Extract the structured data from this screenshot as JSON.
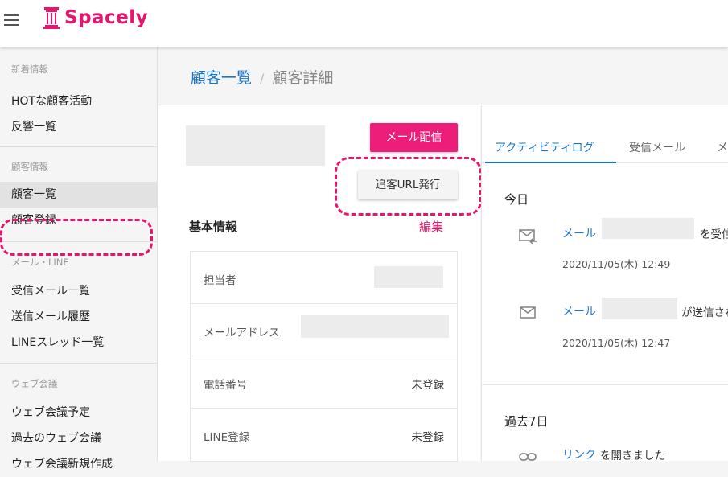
{
  "app": {
    "logo_text": "Spacely",
    "brand_color": "#e8156e"
  },
  "sidebar": {
    "sections": [
      {
        "title": "新着情報",
        "items": [
          {
            "label": "HOTな顧客活動"
          },
          {
            "label": "反響一覧"
          }
        ]
      },
      {
        "title": "顧客情報",
        "items": [
          {
            "label": "顧客一覧",
            "active": true
          },
          {
            "label": "顧客登録"
          }
        ]
      },
      {
        "title": "メール・LINE",
        "items": [
          {
            "label": "受信メール一覧"
          },
          {
            "label": "送信メール履歴"
          },
          {
            "label": "LINEスレッド一覧"
          }
        ]
      },
      {
        "title": "ウェブ会議",
        "items": [
          {
            "label": "ウェブ会議予定"
          },
          {
            "label": "過去のウェブ会議"
          },
          {
            "label": "ウェブ会議新規作成"
          }
        ]
      }
    ]
  },
  "breadcrumb": {
    "parent": "顧客一覧",
    "separator": "/",
    "current": "顧客詳細"
  },
  "customer": {
    "mail_button": "メール配信",
    "url_button": "追客URL発行",
    "basic_info_title": "基本情報",
    "edit_label": "編集",
    "fields": [
      {
        "label": "担当者",
        "value": ""
      },
      {
        "label": "メールアドレス",
        "value": ""
      },
      {
        "label": "電話番号",
        "value": "未登録"
      },
      {
        "label": "LINE登録",
        "value": "未登録"
      }
    ]
  },
  "activity": {
    "tabs": [
      {
        "label": "アクティビティログ",
        "active": true
      },
      {
        "label": "受信メール"
      },
      {
        "label": "メ"
      }
    ],
    "today_title": "今日",
    "past_title": "過去7日",
    "items": [
      {
        "icon": "mail-receive-icon",
        "link": "メール",
        "text": "を受信",
        "time": "2020/11/05(木) 12:49"
      },
      {
        "icon": "mail-icon",
        "link": "メール",
        "text": "が送信され",
        "time": "2020/11/05(木) 12:47"
      },
      {
        "icon": "link-icon",
        "link": "リンク",
        "text": "を開きました",
        "time": ""
      }
    ]
  }
}
